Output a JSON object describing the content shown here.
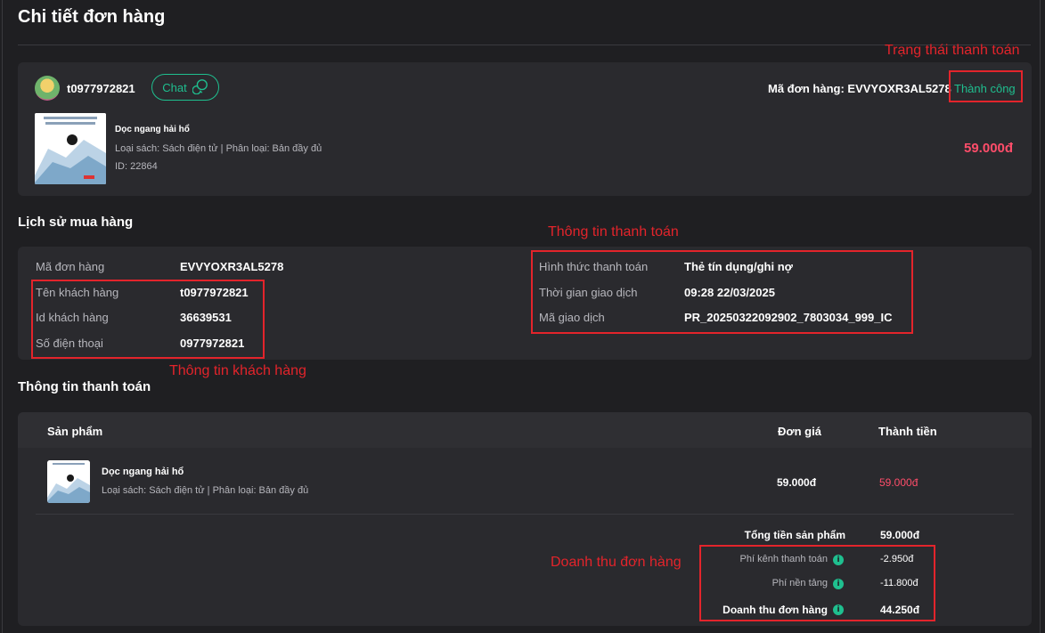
{
  "page": {
    "title": "Chi tiết đơn hàng"
  },
  "order": {
    "seller": "t0977972821",
    "chat_label": "Chat",
    "order_code_label": "Mã đơn hàng: EVVYOXR3AL5278",
    "status": "Thành công",
    "book": {
      "title": "Dọc ngang hải hổ",
      "meta": "Loại sách: Sách điện tử | Phân loại: Bản đầy đủ",
      "id": "ID: 22864",
      "price": "59.000đ"
    }
  },
  "history": {
    "heading": "Lịch sử mua hàng",
    "left": [
      {
        "label": "Mã đơn hàng",
        "value": "EVVYOXR3AL5278"
      },
      {
        "label": "Tên khách hàng",
        "value": "t0977972821"
      },
      {
        "label": "Id khách hàng",
        "value": "36639531"
      },
      {
        "label": "Số điện thoại",
        "value": "0977972821"
      }
    ],
    "right": [
      {
        "label": "Hình thức thanh toán",
        "value": "Thẻ tín dụng/ghi nợ"
      },
      {
        "label": "Thời gian giao dịch",
        "value": "09:28 22/03/2025"
      },
      {
        "label": "Mã giao dịch",
        "value": "PR_20250322092902_7803034_999_IC"
      }
    ]
  },
  "payment": {
    "heading": "Thông tin thanh toán",
    "columns": {
      "product": "Sản phẩm",
      "unit_price": "Đơn giá",
      "total": "Thành tiền"
    },
    "row": {
      "title": "Dọc ngang hải hổ",
      "meta": "Loại sách: Sách điện tử | Phân loại: Bản đầy đủ",
      "unit_price": "59.000đ",
      "total": "59.000đ"
    },
    "summary": {
      "subtotal_label": "Tổng tiền sản phẩm",
      "subtotal_value": "59.000đ",
      "channel_fee_label": "Phí kênh thanh toán",
      "channel_fee_value": "-2.950đ",
      "platform_fee_label": "Phí nền tảng",
      "platform_fee_value": "-11.800đ",
      "revenue_label": "Doanh thu đơn hàng",
      "revenue_value": "44.250đ"
    }
  },
  "annotations": {
    "payment_status": "Trạng thái thanh toán",
    "payment_info": "Thông tin thanh toán",
    "customer_info": "Thông tin khách hàng",
    "order_revenue": "Doanh thu đơn hàng"
  },
  "colors": {
    "accent": "#1fbf8f",
    "price": "#ff4d6a",
    "annotation": "#e3242b"
  }
}
